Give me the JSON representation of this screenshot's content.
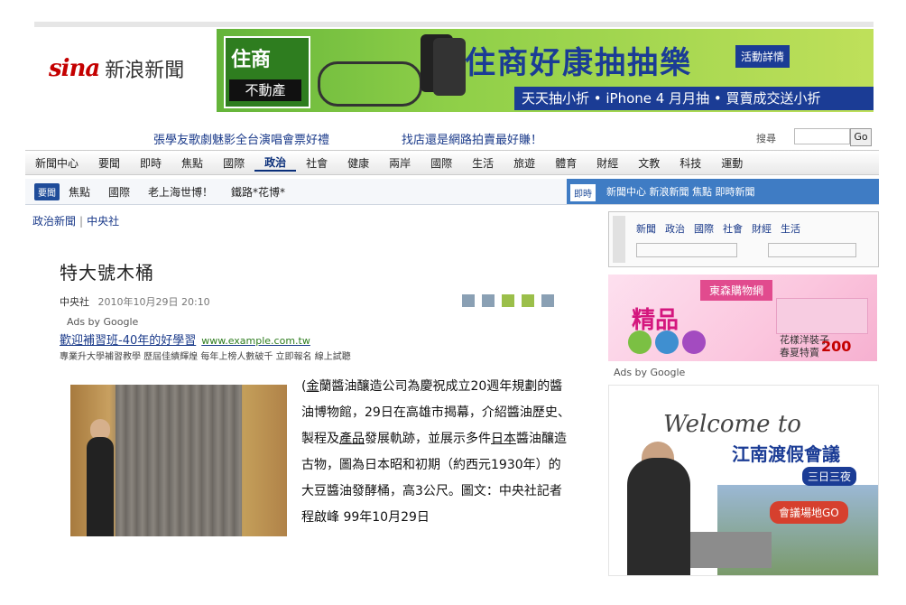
{
  "header": {
    "logo_brand": "sina",
    "logo_text": "新浪新聞",
    "banner": {
      "box_top": "住商",
      "box_bottom": "不動產",
      "title": "住商好康抽抽樂",
      "tag": "活動詳情",
      "subtitle": "天天抽小折 • iPhone 4 月月抽 • 買賣成交送小折"
    },
    "promo_left": "張學友歌劇魅影全台演唱會票好禮",
    "promo_right": "找店還是網路拍賣最好賺！",
    "search_label": "搜尋",
    "search_placeholder": "",
    "go_label": "Go"
  },
  "nav": {
    "items": [
      "新聞中心",
      "要聞",
      "即時",
      "焦點",
      "國際",
      "政治",
      "社會",
      "健康",
      "兩岸",
      "國際",
      "生活",
      "旅遊",
      "體育",
      "財經",
      "文教",
      "科技",
      "運動"
    ],
    "active_index": 5
  },
  "subnav": {
    "badge": "要聞",
    "items": [
      "焦點",
      "國際",
      "老上海世博！",
      "鐵路*花博*"
    ],
    "right_badge": "即時",
    "right_text": "新聞中心 新浪新聞 焦點 即時新聞"
  },
  "breadcrumb": [
    "政治新聞",
    "中央社"
  ],
  "article": {
    "title": "特大號木桶",
    "source": "中央社",
    "date": "2010年10月29日 20:10",
    "ads_label": "Ads by Google",
    "ad_title": "歡迎補習班-40年的好學習",
    "ad_url": "www.example.com.tw",
    "ad_desc": "專業升大學補習教學 歷屆佳績輝煌 每年上榜人數破千 立即報名 線上試聽",
    "body_prefix": "(",
    "body_ul1": "金",
    "body_ul1_rest": "蘭醬油釀造公司",
    "body_ul2": "",
    "body_mid": "為慶祝成立20週年規劃的醬油博物館，29日在高雄市揭幕，介紹醬油歷史、製程及",
    "body_ul3": "產品",
    "body_mid2": "發展軌跡，並展示多件",
    "body_ul4": "日本",
    "body_end": "醬油釀造古物，圖為日本昭和初期（約西元1930年）的大豆醬油發酵桶，高3公尺。圖文：中央社記者程啟峰 99年10月29日"
  },
  "sidebar": {
    "links": [
      "新聞",
      "政治",
      "國際",
      "社會",
      "財經",
      "生活"
    ],
    "ad1": {
      "ribbon": "東森購物網",
      "big": "精品",
      "label1": "花樣洋裝子",
      "label2": "春夏特賣",
      "price": "200"
    },
    "ads_label": "Ads by Google",
    "ad2": {
      "welcome": "Welcome to",
      "name": "江南渡假會議",
      "badge": "三日三夜",
      "go": "會議場地GO"
    }
  }
}
